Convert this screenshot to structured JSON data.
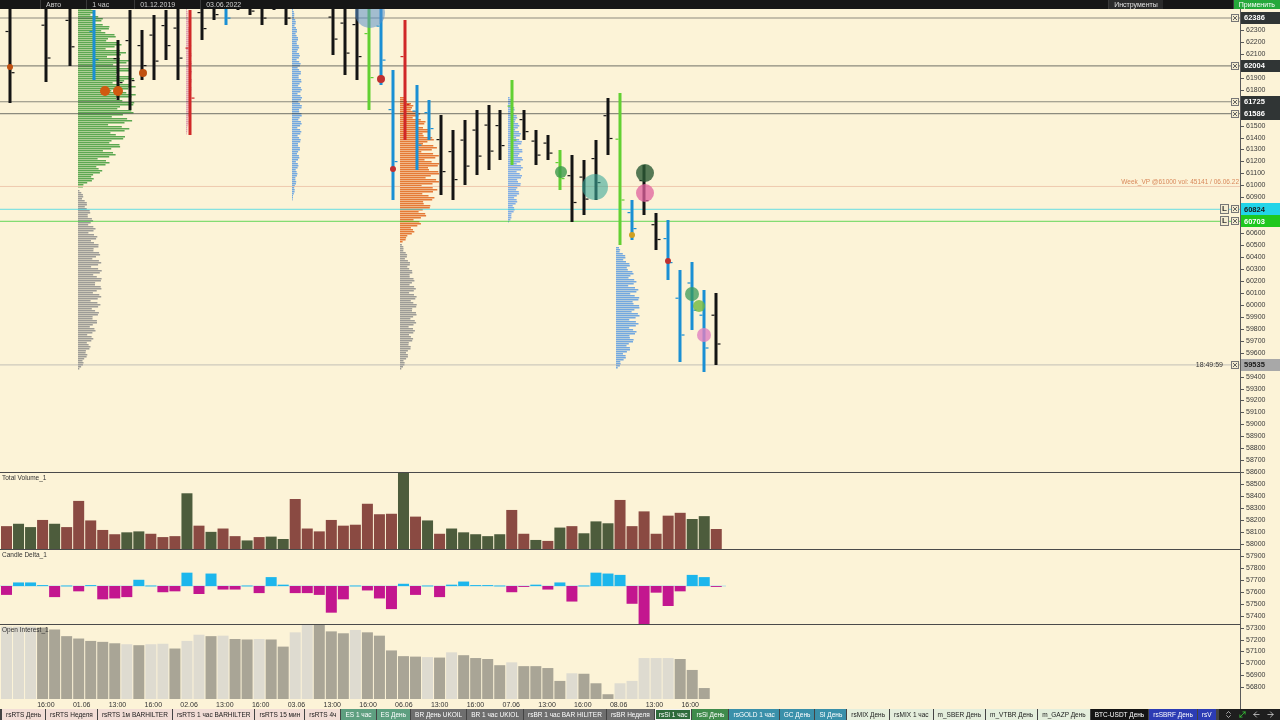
{
  "toolbar": {
    "items": [
      {
        "kind": "field",
        "label": "Авто"
      },
      {
        "kind": "field",
        "label": "1 час"
      },
      {
        "kind": "field",
        "label": "01.12.2019"
      },
      {
        "kind": "field",
        "label": "03.06.2022"
      },
      {
        "kind": "menu",
        "label": "Инструменты"
      },
      {
        "kind": "apply",
        "label": "Применить"
      }
    ]
  },
  "price_axis": [
    {
      "kind": "marker",
      "label": "62386",
      "color": "#303535"
    },
    {
      "kind": "tick",
      "label": "62300"
    },
    {
      "kind": "tick",
      "label": "62200"
    },
    {
      "kind": "tick",
      "label": "62100"
    },
    {
      "kind": "marker",
      "label": "62004",
      "color": "#303535"
    },
    {
      "kind": "tick",
      "label": "61900"
    },
    {
      "kind": "tick",
      "label": "61800"
    },
    {
      "kind": "marker",
      "label": "61725",
      "color": "#303535"
    },
    {
      "kind": "marker",
      "label": "61586",
      "color": "#303535"
    },
    {
      "kind": "tick",
      "label": "61500"
    },
    {
      "kind": "tick",
      "label": "61400"
    },
    {
      "kind": "tick",
      "label": "61300"
    },
    {
      "kind": "tick",
      "label": "61200"
    },
    {
      "kind": "tick",
      "label": "61100"
    },
    {
      "kind": "tick",
      "label": "61000",
      "note": "Week_VP @61000 vol: 45141 / 06.06.22"
    },
    {
      "kind": "tick",
      "label": "60900"
    },
    {
      "kind": "marker",
      "label": "60824",
      "color": "#22d4e8",
      "flag": "L"
    },
    {
      "kind": "marker",
      "label": "60703",
      "color": "#1fc81f",
      "flag": "L"
    },
    {
      "kind": "tick",
      "label": "60600"
    },
    {
      "kind": "tick",
      "label": "60500"
    },
    {
      "kind": "tick",
      "label": "60400"
    },
    {
      "kind": "tick",
      "label": "60300"
    },
    {
      "kind": "tick",
      "label": "60200"
    },
    {
      "kind": "tick",
      "label": "60100"
    },
    {
      "kind": "tick",
      "label": "60000"
    },
    {
      "kind": "tick",
      "label": "59900"
    },
    {
      "kind": "tick",
      "label": "59800"
    },
    {
      "kind": "tick",
      "label": "59700"
    },
    {
      "kind": "tick",
      "label": "59600"
    },
    {
      "kind": "marker",
      "label": "59535",
      "color": "#a8a8a8",
      "timer": "18:49:59"
    },
    {
      "kind": "tick",
      "label": "59400"
    },
    {
      "kind": "tick",
      "label": "59300"
    },
    {
      "kind": "tick",
      "label": "59200"
    },
    {
      "kind": "tick",
      "label": "59100"
    },
    {
      "kind": "tick",
      "label": "59000"
    },
    {
      "kind": "tick",
      "label": "58900"
    },
    {
      "kind": "tick",
      "label": "58800"
    },
    {
      "kind": "tick",
      "label": "58700"
    },
    {
      "kind": "tick",
      "label": "58600"
    },
    {
      "kind": "tick",
      "label": "58500"
    },
    {
      "kind": "tick",
      "label": "58400"
    },
    {
      "kind": "tick",
      "label": "58300"
    },
    {
      "kind": "tick",
      "label": "58200"
    },
    {
      "kind": "tick",
      "label": "58100"
    },
    {
      "kind": "tick",
      "label": "58000"
    },
    {
      "kind": "tick",
      "label": "57900"
    },
    {
      "kind": "tick",
      "label": "57800"
    },
    {
      "kind": "tick",
      "label": "57700"
    },
    {
      "kind": "tick",
      "label": "57600"
    },
    {
      "kind": "tick",
      "label": "57500"
    },
    {
      "kind": "tick",
      "label": "57400"
    },
    {
      "kind": "tick",
      "label": "57300"
    },
    {
      "kind": "tick",
      "label": "57200"
    },
    {
      "kind": "tick",
      "label": "57100"
    },
    {
      "kind": "tick",
      "label": "57000"
    },
    {
      "kind": "tick",
      "label": "56900"
    },
    {
      "kind": "tick",
      "label": "56800"
    }
  ],
  "indicators": [
    {
      "kind": "volume",
      "title": "Total Volume_1"
    },
    {
      "kind": "delta",
      "title": "Candle Delta_1"
    },
    {
      "kind": "oi",
      "title": "Open Interest_1"
    }
  ],
  "time_axis": [
    "16:00",
    "01.06",
    "13:00",
    "16:00",
    "02.06",
    "13:00",
    "16:00",
    "03.06",
    "13:00",
    "16:00",
    "06.06",
    "13:00",
    "16:00",
    "07.06",
    "13:00",
    "16:00",
    "08.06",
    "13:00",
    "16:00"
  ],
  "tabs": [
    {
      "label": "rsRTS День",
      "color": "#f2ddd6",
      "selected": false
    },
    {
      "label": "rsRTS Неделя",
      "color": "#f2ddd6",
      "selected": false
    },
    {
      "label": "rsRTS 1м BARHILTER",
      "color": "#f2ddd6",
      "selected": false
    },
    {
      "label": "rsRTS 1 час BARHILTER",
      "color": "#f2ddd6",
      "selected": false
    },
    {
      "label": "rsRTS 15 мин",
      "color": "#f2ddd6",
      "selected": false
    },
    {
      "label": "rsRTS 4ч",
      "color": "#f2ddd6",
      "selected": false
    },
    {
      "label": "ES 1 час",
      "color": "#5e9f80",
      "selected": false
    },
    {
      "label": "ES День",
      "color": "#5e9f80",
      "selected": false
    },
    {
      "label": "BR День UKOIL",
      "color": "#6e6e6e",
      "selected": false
    },
    {
      "label": "BR 1 час UKIOL",
      "color": "#6e6e6e",
      "selected": false
    },
    {
      "label": "rsBR 1 час BAR HILITER",
      "color": "#6e6e6e",
      "selected": false
    },
    {
      "label": "rsBR Неделя",
      "color": "#6e6e6e",
      "selected": false
    },
    {
      "label": "rsSi 1 час",
      "color": "#2f6b3c",
      "selected": true
    },
    {
      "label": "rsSi День",
      "color": "#3f8b4c",
      "selected": false
    },
    {
      "label": "rsGOLD 1 час",
      "color": "#3a90aa",
      "selected": false
    },
    {
      "label": "GC День",
      "color": "#3a90aa",
      "selected": false
    },
    {
      "label": "SI День",
      "color": "#3a90aa",
      "selected": false
    },
    {
      "label": "rsMIX День",
      "color": "#e4eedc",
      "selected": false
    },
    {
      "label": "rsMIX 1 час",
      "color": "#e4eedc",
      "selected": false
    },
    {
      "label": "m_SBER День",
      "color": "#e4eedc",
      "selected": false
    },
    {
      "label": "m_VTBR День",
      "color": "#e4eedc",
      "selected": false
    },
    {
      "label": "m_GAZP День",
      "color": "#e4eedc",
      "selected": false
    },
    {
      "label": "BTC-USDT День",
      "color": "#141414",
      "selected": false
    },
    {
      "label": "rsSBRF День",
      "color": "#2c3cb4",
      "selected": false
    },
    {
      "label": "rsV",
      "color": "#2c3cb4",
      "selected": false
    }
  ]
}
